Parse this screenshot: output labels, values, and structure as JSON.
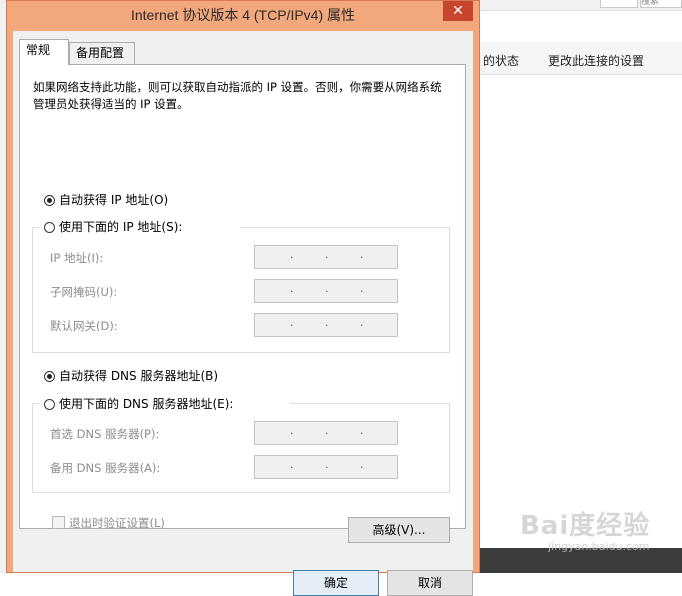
{
  "background": {
    "search_placeholder": "搜索",
    "links": [
      "的状态",
      "更改此连接的设置"
    ],
    "watermark": "Bai度经验",
    "watermark_sub": "jingyan.baidu.com"
  },
  "dialog": {
    "title": "Internet 协议版本 4 (TCP/IPv4) 属性",
    "close_glyph": "✕",
    "tabs": [
      {
        "label": "常规",
        "active": true
      },
      {
        "label": "备用配置",
        "active": false
      }
    ],
    "intro_text": "如果网络支持此功能，则可以获取自动指派的 IP 设置。否则，你需要从网络系统管理员处获得适当的 IP 设置。",
    "ip": {
      "auto_label": "自动获得 IP 地址(O)",
      "manual_label": "使用下面的 IP 地址(S):",
      "selected": "auto",
      "fields": [
        {
          "label": "IP 地址(I):",
          "value": ""
        },
        {
          "label": "子网掩码(U):",
          "value": ""
        },
        {
          "label": "默认网关(D):",
          "value": ""
        }
      ]
    },
    "dns": {
      "auto_label": "自动获得 DNS 服务器地址(B)",
      "manual_label": "使用下面的 DNS 服务器地址(E):",
      "selected": "auto",
      "fields": [
        {
          "label": "首选 DNS 服务器(P):",
          "value": ""
        },
        {
          "label": "备用 DNS 服务器(A):",
          "value": ""
        }
      ]
    },
    "validate_label": "退出时验证设置(L)",
    "validate_checked": false,
    "advanced_label": "高级(V)...",
    "ok_label": "确定",
    "cancel_label": "取消",
    "colors": {
      "titlebar": "#f3a77c",
      "close": "#c7442f",
      "disabled_text": "#8d8d8d"
    }
  }
}
